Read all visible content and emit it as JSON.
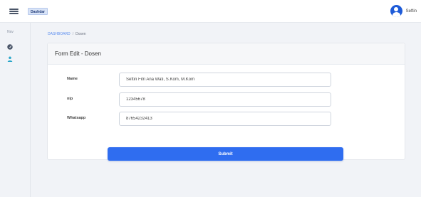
{
  "navbar": {
    "brand_label": "Dashdar",
    "username": "Seftin",
    "menu_icon": "hamburger-icon",
    "avatar_icon": "user-circle-icon",
    "accent_color": "#1e5bd8"
  },
  "sidebar": {
    "section_label": "Nav",
    "items": [
      {
        "icon": "dashboard-gauge-icon"
      },
      {
        "icon": "user-icon",
        "active": true
      }
    ]
  },
  "breadcrumb": {
    "home": "DASHBOARD",
    "separator": "/",
    "current": "Dosen"
  },
  "form": {
    "title": "Form Edit - Dosen",
    "fields": [
      {
        "label": "Name",
        "value": "Seftin Fitri Ana Wati, S.Kom, M.Kom"
      },
      {
        "label": "nip",
        "value": "12345678"
      },
      {
        "label": "Whatsapp",
        "value": "87654232413"
      }
    ],
    "submit_label": "Submit",
    "submit_color": "#2f6df0"
  }
}
